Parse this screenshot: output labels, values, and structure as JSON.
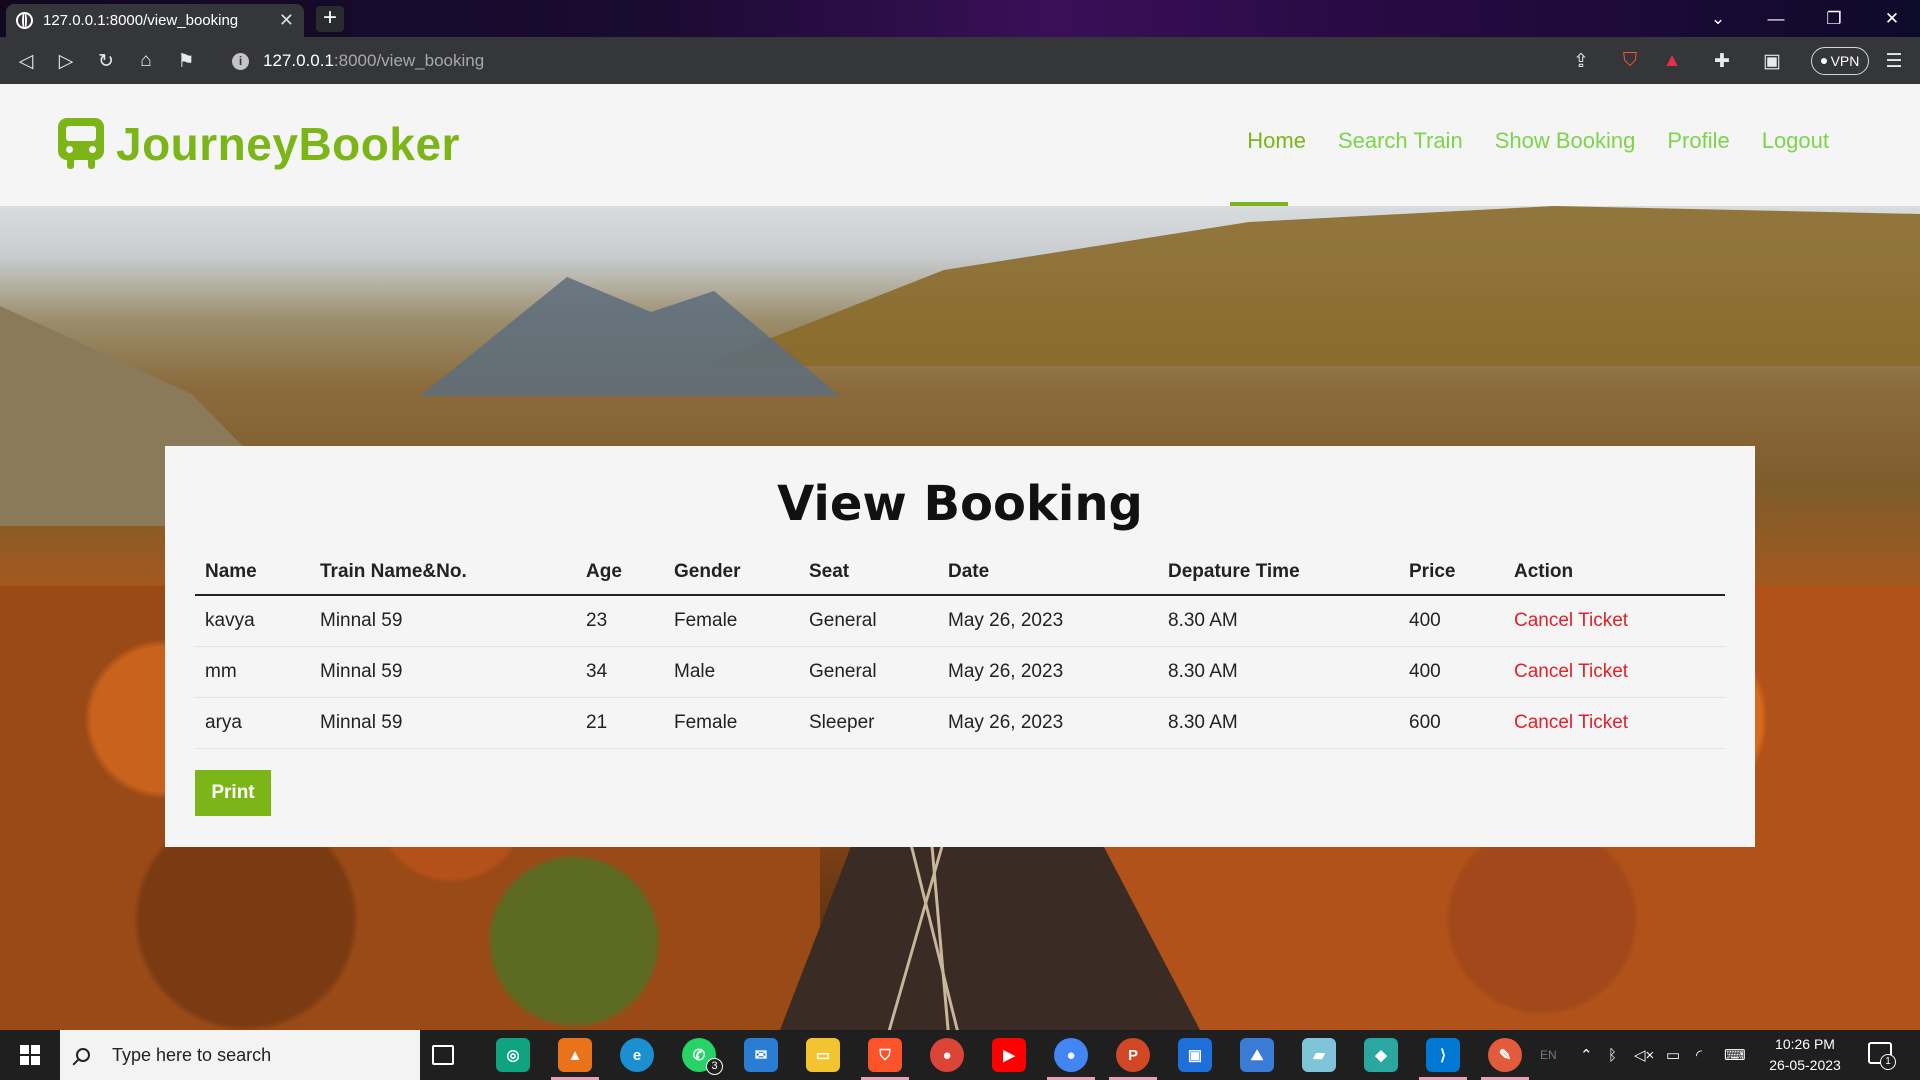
{
  "browser": {
    "tab_title": "127.0.0.1:8000/view_booking",
    "tab_close": "✕",
    "new_tab": "+",
    "url_host": "127.0.0.1",
    "url_path": ":8000/view_booking",
    "vpn_label": "VPN"
  },
  "site": {
    "brand": "JourneyBooker",
    "nav": [
      "Home",
      "Search Train",
      "Show Booking",
      "Profile",
      "Logout"
    ],
    "accent": "#7cb518"
  },
  "booking": {
    "title": "View Booking",
    "columns": [
      "Name",
      "Train Name&No.",
      "Age",
      "Gender",
      "Seat",
      "Date",
      "Depature Time",
      "Price",
      "Action"
    ],
    "rows": [
      [
        "kavya",
        "Minnal 59",
        "23",
        "Female",
        "General",
        "May 26, 2023",
        "8.30 AM",
        "400",
        "Cancel Ticket"
      ],
      [
        "mm",
        "Minnal 59",
        "34",
        "Male",
        "General",
        "May 26, 2023",
        "8.30 AM",
        "400",
        "Cancel Ticket"
      ],
      [
        "arya",
        "Minnal 59",
        "21",
        "Female",
        "Sleeper",
        "May 26, 2023",
        "8.30 AM",
        "600",
        "Cancel Ticket"
      ]
    ],
    "print_label": "Print",
    "cancel_color": "#e0212a"
  },
  "taskbar": {
    "search_placeholder": "Type here to search",
    "whatsapp_badge": "3",
    "lang": "EN",
    "time": "10:26 PM",
    "date": "26-05-2023",
    "notification_count": "1"
  }
}
